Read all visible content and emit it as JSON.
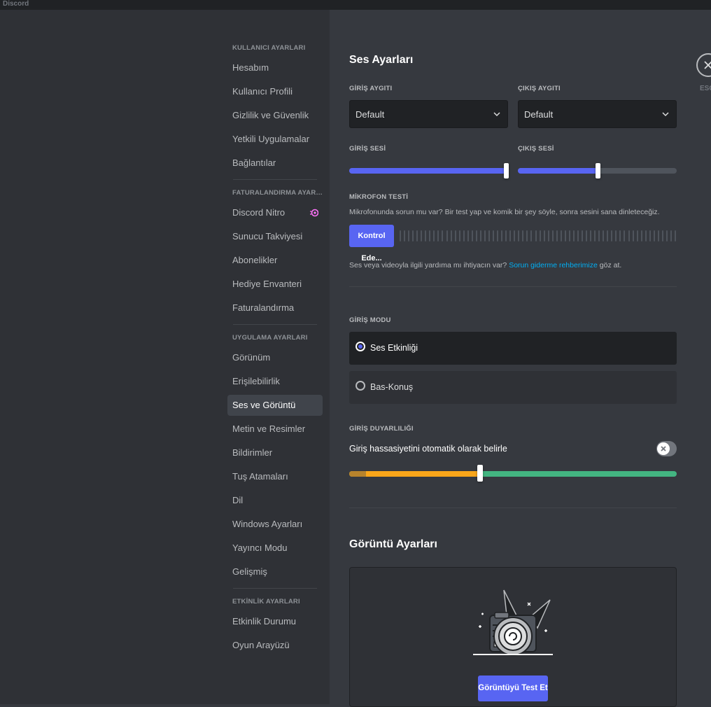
{
  "app": {
    "title": "Discord"
  },
  "sidebar": {
    "categories": [
      {
        "label": "KULLANICI AYARLARI",
        "items": [
          "Hesabım",
          "Kullanıcı Profili",
          "Gizlilik ve Güvenlik",
          "Yetkili Uygulamalar",
          "Bağlantılar"
        ]
      },
      {
        "label": "FATURALANDIRMA AYARLA...",
        "items": [
          "Discord Nitro",
          "Sunucu Takviyesi",
          "Abonelikler",
          "Hediye Envanteri",
          "Faturalandırma"
        ]
      },
      {
        "label": "UYGULAMA AYARLARI",
        "items": [
          "Görünüm",
          "Erişilebilirlik",
          "Ses ve Görüntü",
          "Metin ve Resimler",
          "Bildirimler",
          "Tuş Atamaları",
          "Dil",
          "Windows Ayarları",
          "Yayıncı Modu",
          "Gelişmiş"
        ]
      },
      {
        "label": "ETKİNLİK AYARLARI",
        "items": [
          "Etkinlik Durumu",
          "Oyun Arayüzü"
        ]
      }
    ],
    "active_item": "Ses ve Görüntü",
    "nitro_icon": "nitro-icon",
    "nitro_color": "#ff73fa"
  },
  "voice": {
    "title": "Ses Ayarları",
    "input_device_label": "GİRİŞ AYGITI",
    "input_device_value": "Default",
    "output_device_label": "ÇIKIŞ AYGITI",
    "output_device_value": "Default",
    "input_volume_label": "GİRİŞ SESİ",
    "input_volume_level": 1.0,
    "output_volume_label": "ÇIKIŞ SESİ",
    "output_volume_level": 0.5,
    "mic_test_label": "MİKROFON TESTİ",
    "mic_test_desc": "Mikrofonunda sorun mu var? Bir test yap ve komik bir şey söyle, sonra sesini sana dinleteceğiz.",
    "mic_test_button": "Kontrol Ede...",
    "help_prefix": "Ses veya videoyla ilgili yardıma mı ihtiyacın var?",
    "help_link": "Sorun giderme rehberimize",
    "help_suffix": "göz at.",
    "input_mode_label": "GİRİŞ MODU",
    "modes": [
      {
        "label": "Ses Etkinliği",
        "selected": true
      },
      {
        "label": "Bas-Konuş",
        "selected": false
      }
    ],
    "sensitivity_label": "GİRİŞ DUYARLILIĞI",
    "auto_sensitivity_text": "Giriş hassasiyetini otomatik olarak belirle",
    "auto_sensitivity_enabled": false,
    "sensitivity_level": 0.4
  },
  "video": {
    "title": "Görüntü Ayarları",
    "test_button": "Görüntüyü Test Et",
    "illustration": "camera-illustration"
  },
  "close": {
    "icon": "close-icon",
    "label": "ESC"
  },
  "colors": {
    "accent": "#5865f2",
    "link": "#00aff4",
    "green": "#43b581",
    "yellow": "#faa61a"
  }
}
